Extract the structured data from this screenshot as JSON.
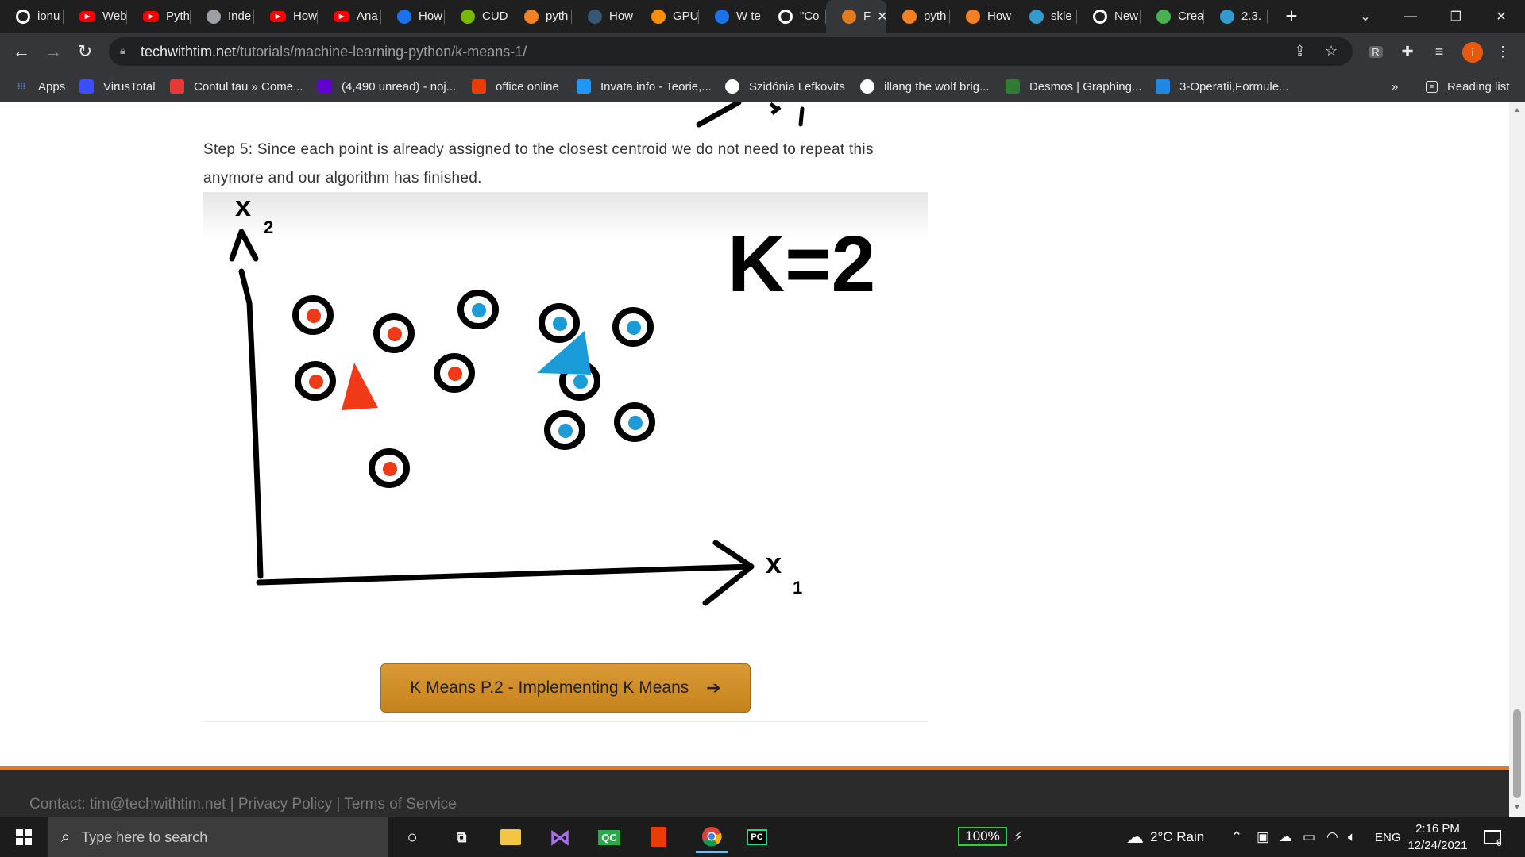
{
  "tabs": [
    {
      "label": "ionu",
      "icon": "github-icon",
      "color": "#ffffff"
    },
    {
      "label": "Web",
      "icon": "youtube-icon",
      "color": "#ff0000"
    },
    {
      "label": "Pyth",
      "icon": "youtube-icon",
      "color": "#ff0000"
    },
    {
      "label": "Inde",
      "icon": "globe-icon",
      "color": "#9aa0a6"
    },
    {
      "label": "How",
      "icon": "youtube-icon",
      "color": "#ff0000"
    },
    {
      "label": "Ana",
      "icon": "youtube-icon",
      "color": "#ff0000"
    },
    {
      "label": "How",
      "icon": "blue-eye-icon",
      "color": "#1a73e8"
    },
    {
      "label": "CUD",
      "icon": "nvidia-icon",
      "color": "#76b900"
    },
    {
      "label": "pyth",
      "icon": "stackoverflow-icon",
      "color": "#f48024"
    },
    {
      "label": "How",
      "icon": "tds-icon",
      "color": "#355876"
    },
    {
      "label": "GPU",
      "icon": "tensorflow-icon",
      "color": "#ff8f00"
    },
    {
      "label": "W te",
      "icon": "circle-icon",
      "color": "#1a73e8"
    },
    {
      "label": "\"Co",
      "icon": "github-icon",
      "color": "#ffffff"
    },
    {
      "label": "F",
      "icon": "techwithtim-icon",
      "color": "#e07b1f",
      "active": true
    },
    {
      "label": "pyth",
      "icon": "stackoverflow-icon",
      "color": "#f48024"
    },
    {
      "label": "How",
      "icon": "stackoverflow-icon",
      "color": "#f48024"
    },
    {
      "label": "skle",
      "icon": "sklearn-icon",
      "color": "#3499cd"
    },
    {
      "label": "New",
      "icon": "chrome-icon",
      "color": "#ffffff"
    },
    {
      "label": "Crea",
      "icon": "image-icon",
      "color": "#4caf50"
    },
    {
      "label": "2.3.",
      "icon": "sklearn-icon",
      "color": "#3499cd"
    }
  ],
  "toolbar": {
    "url_host": "techwithtim.net",
    "url_path": "/tutorials/machine-learning-python/k-means-1/"
  },
  "bookmarks": [
    {
      "label": "Apps",
      "icon": "apps-grid-icon",
      "color": "#4285f4"
    },
    {
      "label": "VirusTotal",
      "icon": "virustotal-icon",
      "color": "#394eff"
    },
    {
      "label": "Contul tau » Come...",
      "icon": "emag-icon",
      "color": "#e53935"
    },
    {
      "label": "(4,490 unread) - noj...",
      "icon": "yahoo-mail-icon",
      "color": "#6001d2"
    },
    {
      "label": "office online",
      "icon": "office-icon",
      "color": "#eb3c00"
    },
    {
      "label": "Invata.info - Teorie,...",
      "icon": "invata-icon",
      "color": "#2196f3"
    },
    {
      "label": "Szidónia Lefkovits",
      "icon": "globe-icon",
      "color": "#ffffff"
    },
    {
      "label": "illang the wolf brig...",
      "icon": "google-icon",
      "color": "#ffffff"
    },
    {
      "label": "Desmos | Graphing...",
      "icon": "desmos-icon",
      "color": "#2e7d32"
    },
    {
      "label": "3-Operatii,Formule...",
      "icon": "s-icon",
      "color": "#1e88e5"
    }
  ],
  "bookmarks_more": "»",
  "reading_list": "Reading list",
  "article": {
    "step5_text": "Step 5: Since each point is already assigned to the closest centroid we do not need to repeat this anymore and our algorithm has finished.",
    "next_button": "K Means P.2 - Implementing K Means",
    "next_arrow": "➔"
  },
  "figure": {
    "k_label": "K=2",
    "x_axis_label": "x",
    "x_axis_sub": "1",
    "y_axis_label": "x",
    "y_axis_sub": "2",
    "red_color": "#f03a17",
    "blue_color": "#1a9cd8"
  },
  "footer": {
    "text": "Contact: tim@techwithtim.net | Privacy Policy | Terms of Service"
  },
  "taskbar": {
    "search_placeholder": "Type here to search",
    "battery": "100%",
    "weather": "2°C Rain",
    "language": "ENG",
    "time": "2:16 PM",
    "date": "12/24/2021",
    "notifications": "6"
  }
}
